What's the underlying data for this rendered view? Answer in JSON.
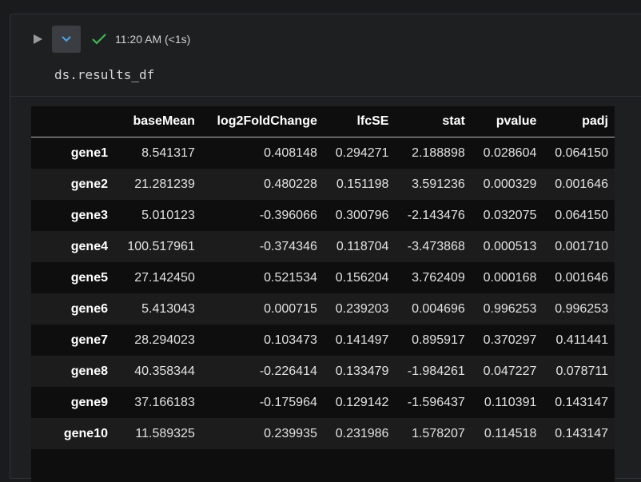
{
  "cell": {
    "exec_time": "11:20 AM (<1s)",
    "code": "ds.results_df",
    "icons": {
      "run": "play-icon",
      "collapse": "chevron-down-icon",
      "status": "check-icon"
    },
    "colors": {
      "success": "#3fb950",
      "accent": "#4ea3e8"
    }
  },
  "table": {
    "columns": [
      "",
      "baseMean",
      "log2FoldChange",
      "lfcSE",
      "stat",
      "pvalue",
      "padj"
    ],
    "rows": [
      [
        "gene1",
        "8.541317",
        "0.408148",
        "0.294271",
        "2.188898",
        "0.028604",
        "0.064150"
      ],
      [
        "gene2",
        "21.281239",
        "0.480228",
        "0.151198",
        "3.591236",
        "0.000329",
        "0.001646"
      ],
      [
        "gene3",
        "5.010123",
        "-0.396066",
        "0.300796",
        "-2.143476",
        "0.032075",
        "0.064150"
      ],
      [
        "gene4",
        "100.517961",
        "-0.374346",
        "0.118704",
        "-3.473868",
        "0.000513",
        "0.001710"
      ],
      [
        "gene5",
        "27.142450",
        "0.521534",
        "0.156204",
        "3.762409",
        "0.000168",
        "0.001646"
      ],
      [
        "gene6",
        "5.413043",
        "0.000715",
        "0.239203",
        "0.004696",
        "0.996253",
        "0.996253"
      ],
      [
        "gene7",
        "28.294023",
        "0.103473",
        "0.141497",
        "0.895917",
        "0.370297",
        "0.411441"
      ],
      [
        "gene8",
        "40.358344",
        "-0.226414",
        "0.133479",
        "-1.984261",
        "0.047227",
        "0.078711"
      ],
      [
        "gene9",
        "37.166183",
        "-0.175964",
        "0.129142",
        "-1.596437",
        "0.110391",
        "0.143147"
      ],
      [
        "gene10",
        "11.589325",
        "0.239935",
        "0.231986",
        "1.578207",
        "0.114518",
        "0.143147"
      ]
    ]
  }
}
